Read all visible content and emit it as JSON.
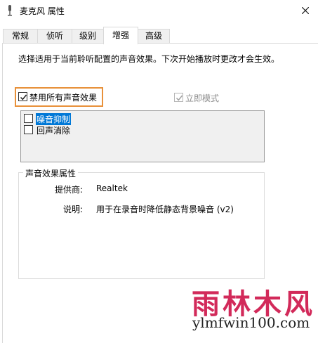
{
  "window": {
    "title": "麦克风 属性",
    "icon": "microphone-icon"
  },
  "tabs": [
    {
      "label": "常规",
      "active": false
    },
    {
      "label": "侦听",
      "active": false
    },
    {
      "label": "级别",
      "active": false
    },
    {
      "label": "增强",
      "active": true
    },
    {
      "label": "高级",
      "active": false
    }
  ],
  "enhancements": {
    "description": "选择适用于当前聆听配置的声音效果。下次开始播放时更改才会生效。",
    "disable_all": {
      "label": "禁用所有声音效果",
      "checked": true
    },
    "immediate_mode": {
      "label": "立即模式",
      "checked": true,
      "enabled": false
    },
    "effects": [
      {
        "label": "噪音抑制",
        "checked": false,
        "selected": true
      },
      {
        "label": "回声消除",
        "checked": false,
        "selected": false
      }
    ]
  },
  "properties": {
    "title": "声音效果属性",
    "provider_label": "提供商:",
    "provider_value": "Realtek",
    "description_label": "说明:",
    "description_value": "用于在录音时降低静态背景噪音 (v2)"
  },
  "watermark": {
    "text": "雨林木风",
    "url": "ylmfwin100.com"
  },
  "colors": {
    "highlight": "#e8913a",
    "selection": "#0078d7",
    "watermark": "#d22a5a"
  }
}
